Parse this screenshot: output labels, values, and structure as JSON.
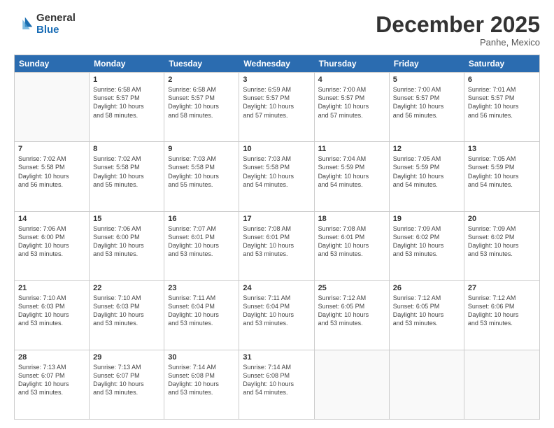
{
  "logo": {
    "general": "General",
    "blue": "Blue"
  },
  "header": {
    "month": "December 2025",
    "location": "Panhe, Mexico"
  },
  "weekdays": [
    "Sunday",
    "Monday",
    "Tuesday",
    "Wednesday",
    "Thursday",
    "Friday",
    "Saturday"
  ],
  "rows": [
    [
      {
        "day": "",
        "info": ""
      },
      {
        "day": "1",
        "info": "Sunrise: 6:58 AM\nSunset: 5:57 PM\nDaylight: 10 hours\nand 58 minutes."
      },
      {
        "day": "2",
        "info": "Sunrise: 6:58 AM\nSunset: 5:57 PM\nDaylight: 10 hours\nand 58 minutes."
      },
      {
        "day": "3",
        "info": "Sunrise: 6:59 AM\nSunset: 5:57 PM\nDaylight: 10 hours\nand 57 minutes."
      },
      {
        "day": "4",
        "info": "Sunrise: 7:00 AM\nSunset: 5:57 PM\nDaylight: 10 hours\nand 57 minutes."
      },
      {
        "day": "5",
        "info": "Sunrise: 7:00 AM\nSunset: 5:57 PM\nDaylight: 10 hours\nand 56 minutes."
      },
      {
        "day": "6",
        "info": "Sunrise: 7:01 AM\nSunset: 5:57 PM\nDaylight: 10 hours\nand 56 minutes."
      }
    ],
    [
      {
        "day": "7",
        "info": "Sunrise: 7:02 AM\nSunset: 5:58 PM\nDaylight: 10 hours\nand 56 minutes."
      },
      {
        "day": "8",
        "info": "Sunrise: 7:02 AM\nSunset: 5:58 PM\nDaylight: 10 hours\nand 55 minutes."
      },
      {
        "day": "9",
        "info": "Sunrise: 7:03 AM\nSunset: 5:58 PM\nDaylight: 10 hours\nand 55 minutes."
      },
      {
        "day": "10",
        "info": "Sunrise: 7:03 AM\nSunset: 5:58 PM\nDaylight: 10 hours\nand 54 minutes."
      },
      {
        "day": "11",
        "info": "Sunrise: 7:04 AM\nSunset: 5:59 PM\nDaylight: 10 hours\nand 54 minutes."
      },
      {
        "day": "12",
        "info": "Sunrise: 7:05 AM\nSunset: 5:59 PM\nDaylight: 10 hours\nand 54 minutes."
      },
      {
        "day": "13",
        "info": "Sunrise: 7:05 AM\nSunset: 5:59 PM\nDaylight: 10 hours\nand 54 minutes."
      }
    ],
    [
      {
        "day": "14",
        "info": "Sunrise: 7:06 AM\nSunset: 6:00 PM\nDaylight: 10 hours\nand 53 minutes."
      },
      {
        "day": "15",
        "info": "Sunrise: 7:06 AM\nSunset: 6:00 PM\nDaylight: 10 hours\nand 53 minutes."
      },
      {
        "day": "16",
        "info": "Sunrise: 7:07 AM\nSunset: 6:01 PM\nDaylight: 10 hours\nand 53 minutes."
      },
      {
        "day": "17",
        "info": "Sunrise: 7:08 AM\nSunset: 6:01 PM\nDaylight: 10 hours\nand 53 minutes."
      },
      {
        "day": "18",
        "info": "Sunrise: 7:08 AM\nSunset: 6:01 PM\nDaylight: 10 hours\nand 53 minutes."
      },
      {
        "day": "19",
        "info": "Sunrise: 7:09 AM\nSunset: 6:02 PM\nDaylight: 10 hours\nand 53 minutes."
      },
      {
        "day": "20",
        "info": "Sunrise: 7:09 AM\nSunset: 6:02 PM\nDaylight: 10 hours\nand 53 minutes."
      }
    ],
    [
      {
        "day": "21",
        "info": "Sunrise: 7:10 AM\nSunset: 6:03 PM\nDaylight: 10 hours\nand 53 minutes."
      },
      {
        "day": "22",
        "info": "Sunrise: 7:10 AM\nSunset: 6:03 PM\nDaylight: 10 hours\nand 53 minutes."
      },
      {
        "day": "23",
        "info": "Sunrise: 7:11 AM\nSunset: 6:04 PM\nDaylight: 10 hours\nand 53 minutes."
      },
      {
        "day": "24",
        "info": "Sunrise: 7:11 AM\nSunset: 6:04 PM\nDaylight: 10 hours\nand 53 minutes."
      },
      {
        "day": "25",
        "info": "Sunrise: 7:12 AM\nSunset: 6:05 PM\nDaylight: 10 hours\nand 53 minutes."
      },
      {
        "day": "26",
        "info": "Sunrise: 7:12 AM\nSunset: 6:05 PM\nDaylight: 10 hours\nand 53 minutes."
      },
      {
        "day": "27",
        "info": "Sunrise: 7:12 AM\nSunset: 6:06 PM\nDaylight: 10 hours\nand 53 minutes."
      }
    ],
    [
      {
        "day": "28",
        "info": "Sunrise: 7:13 AM\nSunset: 6:07 PM\nDaylight: 10 hours\nand 53 minutes."
      },
      {
        "day": "29",
        "info": "Sunrise: 7:13 AM\nSunset: 6:07 PM\nDaylight: 10 hours\nand 53 minutes."
      },
      {
        "day": "30",
        "info": "Sunrise: 7:14 AM\nSunset: 6:08 PM\nDaylight: 10 hours\nand 53 minutes."
      },
      {
        "day": "31",
        "info": "Sunrise: 7:14 AM\nSunset: 6:08 PM\nDaylight: 10 hours\nand 54 minutes."
      },
      {
        "day": "",
        "info": ""
      },
      {
        "day": "",
        "info": ""
      },
      {
        "day": "",
        "info": ""
      }
    ]
  ]
}
